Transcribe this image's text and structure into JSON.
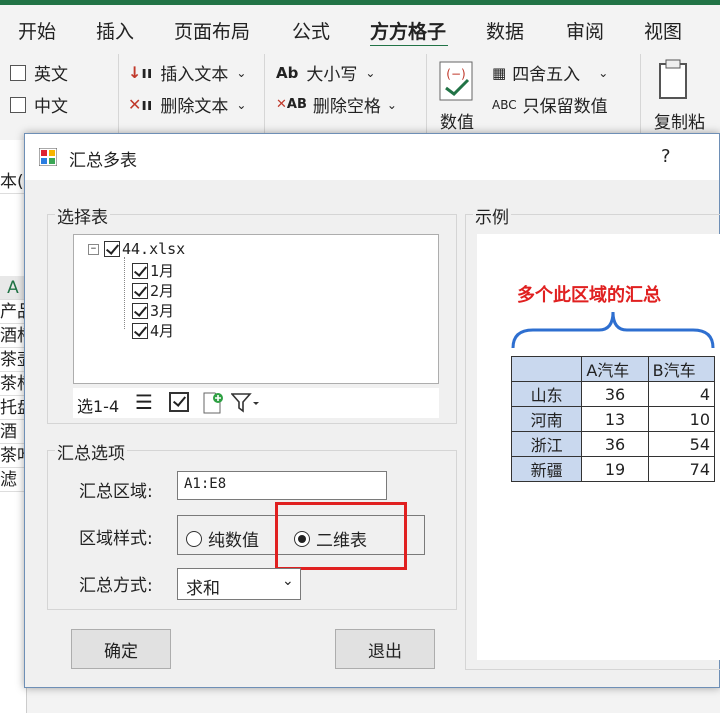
{
  "ribbon": {
    "tabs": [
      "开始",
      "插入",
      "页面布局",
      "公式",
      "方方格子",
      "数据",
      "审阅",
      "视图"
    ],
    "active_tab": "方方格子",
    "accent": "#217346",
    "checks": [
      "英文",
      "中文"
    ],
    "group1": {
      "insert_text": "插入文本",
      "delete_text": "删除文本"
    },
    "group2": {
      "case": "大小写",
      "delete_spaces": "删除空格"
    },
    "group3": {
      "number_label": "数值",
      "round": "四舍五入",
      "keep_values": "只保留数值"
    },
    "paste_label": "复制粘"
  },
  "sheet": {
    "cells": [
      "本(",
      "",
      "",
      "",
      "A",
      "产品",
      "酒杯",
      "茶壶",
      "茶杯",
      "托盘",
      "酒",
      "茶叶",
      "滤"
    ]
  },
  "dialog": {
    "title": "汇总多表",
    "help": "?",
    "select_group": {
      "legend": "选择表",
      "tree": {
        "root": "44.xlsx",
        "sheets": [
          "1月",
          "2月",
          "3月",
          "4月"
        ]
      },
      "toolbar_label": "选1-4"
    },
    "options_group": {
      "legend": "汇总选项",
      "range_label": "汇总区域:",
      "range_value": "A1:E8",
      "style_label": "区域样式:",
      "style_options": [
        "纯数值",
        "二维表"
      ],
      "selected_style": "二维表",
      "method_label": "汇总方式:",
      "method_value": "求和"
    },
    "example_group": {
      "legend": "示例",
      "caption": "多个此区域的汇总",
      "caption_color": "#e02020",
      "brace_color": "#2e6fd0",
      "highlight_color": "#e02020",
      "headers": [
        "",
        "A汽车",
        "B汽车"
      ],
      "rows": [
        [
          "山东",
          "36",
          "4"
        ],
        [
          "河南",
          "13",
          "10"
        ],
        [
          "浙江",
          "36",
          "54"
        ],
        [
          "新疆",
          "19",
          "74"
        ]
      ]
    },
    "ok_label": "确定",
    "exit_label": "退出"
  }
}
